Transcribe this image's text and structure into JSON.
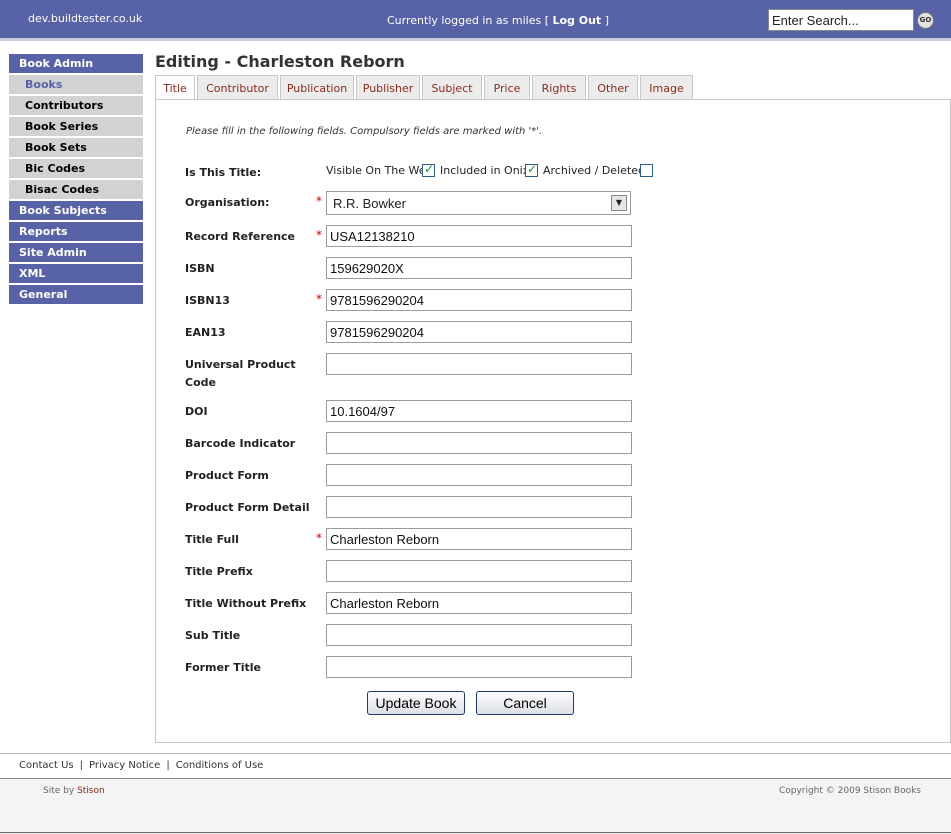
{
  "header": {
    "site_name": "dev.buildtester.co.uk",
    "login_prefix": "Currently logged in as miles [",
    "logout_label": "Log Out",
    "login_suffix": "]",
    "search_value": "Enter Search...",
    "go_label": "GO"
  },
  "sidebar": {
    "book_admin": "Book Admin",
    "books": "Books",
    "contributors": "Contributors",
    "book_series": "Book Series",
    "book_sets": "Book Sets",
    "bic_codes": "Bic Codes",
    "bisac_codes": "Bisac Codes",
    "book_subjects": "Book Subjects",
    "reports": "Reports",
    "site_admin": "Site Admin",
    "xml": "XML",
    "general": "General"
  },
  "page_title": "Editing - Charleston Reborn",
  "tabs": {
    "title": "Title",
    "contributor": "Contributor",
    "publication": "Publication",
    "publisher": "Publisher",
    "subject": "Subject",
    "price": "Price",
    "rights": "Rights",
    "other": "Other",
    "image": "Image"
  },
  "form": {
    "instructions": "Please fill in the following fields. Compulsory fields are marked with '*'.",
    "required_marker": "*",
    "is_this_title": {
      "label": "Is This Title:",
      "visible_label": "Visible On The Web",
      "visible_checked": true,
      "onix_label": "Included in Onix",
      "onix_checked": true,
      "archived_label": "Archived / Deleted",
      "archived_checked": false
    },
    "organisation": {
      "label": "Organisation:",
      "value": "R.R. Bowker"
    },
    "record_reference": {
      "label": "Record Reference",
      "value": "USA12138210"
    },
    "isbn": {
      "label": "ISBN",
      "value": "159629020X"
    },
    "isbn13": {
      "label": "ISBN13",
      "value": "9781596290204"
    },
    "ean13": {
      "label": "EAN13",
      "value": "9781596290204"
    },
    "upc": {
      "label_line1": "Universal Product",
      "label_line2": "Code",
      "value": ""
    },
    "doi": {
      "label": "DOI",
      "value": "10.1604/97"
    },
    "barcode_indicator": {
      "label": "Barcode Indicator",
      "value": ""
    },
    "product_form": {
      "label": "Product Form",
      "value": ""
    },
    "product_form_detail": {
      "label": "Product Form Detail",
      "value": ""
    },
    "title_full": {
      "label": "Title Full",
      "value": "Charleston Reborn"
    },
    "title_prefix": {
      "label": "Title Prefix",
      "value": ""
    },
    "title_without_prefix": {
      "label": "Title Without Prefix",
      "value": "Charleston Reborn"
    },
    "sub_title": {
      "label": "Sub Title",
      "value": ""
    },
    "former_title": {
      "label": "Former Title",
      "value": ""
    },
    "update_label": "Update Book",
    "cancel_label": "Cancel"
  },
  "footer": {
    "contact": "Contact Us",
    "privacy": "Privacy Notice",
    "conditions": "Conditions of Use",
    "separator": "|",
    "site_by_prefix": "Site by",
    "site_by_link": "Stison",
    "copyright": "Copyright © 2009 Stison Books"
  },
  "colors": {
    "header_bg": "#5862a6",
    "tab_text": "#8b2a1a",
    "required": "#cc0000"
  }
}
